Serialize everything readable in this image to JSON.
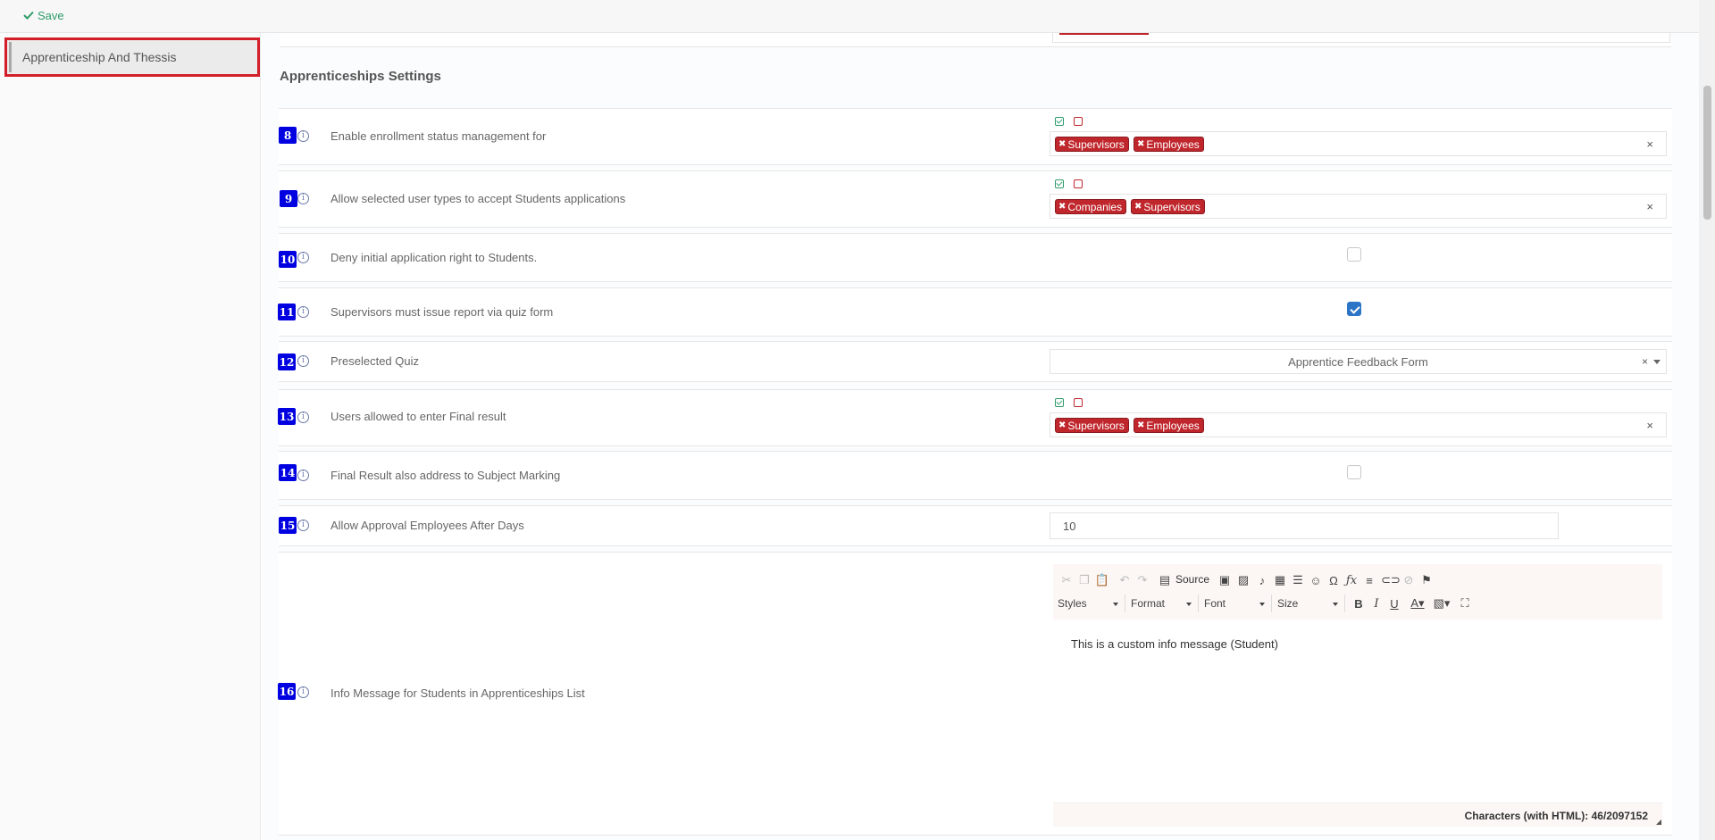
{
  "topbar": {
    "save_label": "Save"
  },
  "sidebar": {
    "items": [
      {
        "label": "Apprenticeship And Thessis"
      }
    ]
  },
  "section": {
    "title": "Apprenticeships Settings"
  },
  "settings": [
    {
      "num": "8",
      "label": "Enable enrollment status management for",
      "tags": [
        "Supervisors",
        "Employees"
      ]
    },
    {
      "num": "9",
      "label": "Allow selected user types to accept Students applications",
      "tags": [
        "Companies",
        "Supervisors"
      ]
    },
    {
      "num": "10",
      "label": "Deny initial application right to Students.",
      "checked": false
    },
    {
      "num": "11",
      "label": "Supervisors must issue report via quiz form",
      "checked": true
    },
    {
      "num": "12",
      "label": "Preselected Quiz",
      "selected": "Apprentice Feedback Form"
    },
    {
      "num": "13",
      "label": "Users allowed to enter Final result",
      "tags": [
        "Supervisors",
        "Employees"
      ]
    },
    {
      "num": "14",
      "label": "Final Result also address to Subject Marking",
      "checked": false
    },
    {
      "num": "15",
      "label": "Allow Approval Employees After Days",
      "value": "10"
    },
    {
      "num": "16",
      "label": "Info Message for Students in Apprenticeships List"
    }
  ],
  "editor": {
    "source_label": "Source",
    "combos": [
      "Styles",
      "Format",
      "Font",
      "Size"
    ],
    "content": "This is a custom info message (Student)",
    "char_count": "Characters (with HTML): 46/2097152",
    "toolbar_icons": [
      "cut-icon",
      "copy-icon",
      "paste-icon",
      "undo-icon",
      "redo-icon",
      "source-icon",
      "image-icon",
      "image2-icon",
      "audio-icon",
      "table-icon",
      "horizontal-line-icon",
      "smiley-icon",
      "special-char-icon",
      "math-icon",
      "bulleted-list-icon",
      "link-icon",
      "unlink-icon",
      "anchor-icon",
      "bold-icon",
      "italic-icon",
      "underline-icon",
      "text-color-icon",
      "background-color-icon",
      "maximize-icon"
    ]
  },
  "colors": {
    "tag_red": "#c0272d",
    "number_badge_blue": "#0000e0",
    "save_green": "#2e9c6a",
    "checkbox_blue": "#2b74c6",
    "highlight_red": "#d21f2a"
  }
}
